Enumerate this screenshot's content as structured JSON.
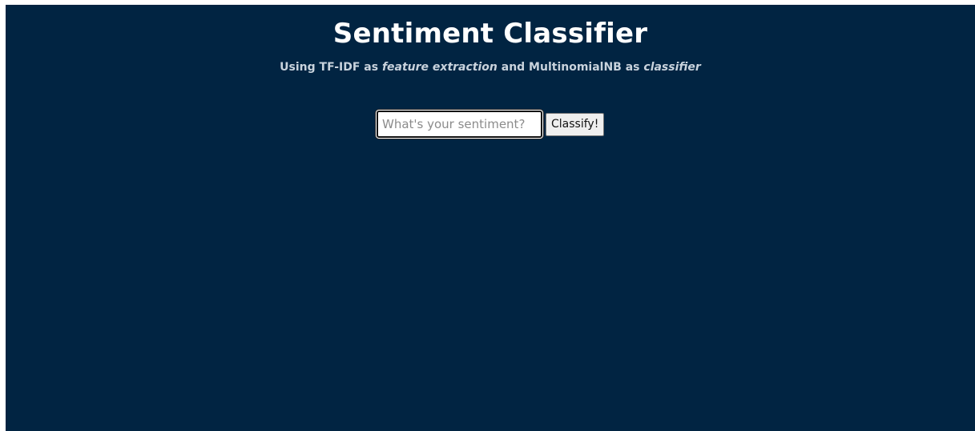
{
  "page": {
    "title": "Sentiment Classifier",
    "subtitle": {
      "prefix": "Using TF-IDF as ",
      "feature_extraction": "feature extraction",
      "middle": " and MultinomialNB as ",
      "classifier": "classifier"
    }
  },
  "form": {
    "input_placeholder": "What's your sentiment?",
    "input_value": "",
    "button_label": "Classify!"
  },
  "colors": {
    "background": "#012442",
    "title": "#ffffff",
    "subtitle": "#c9d3dd"
  }
}
